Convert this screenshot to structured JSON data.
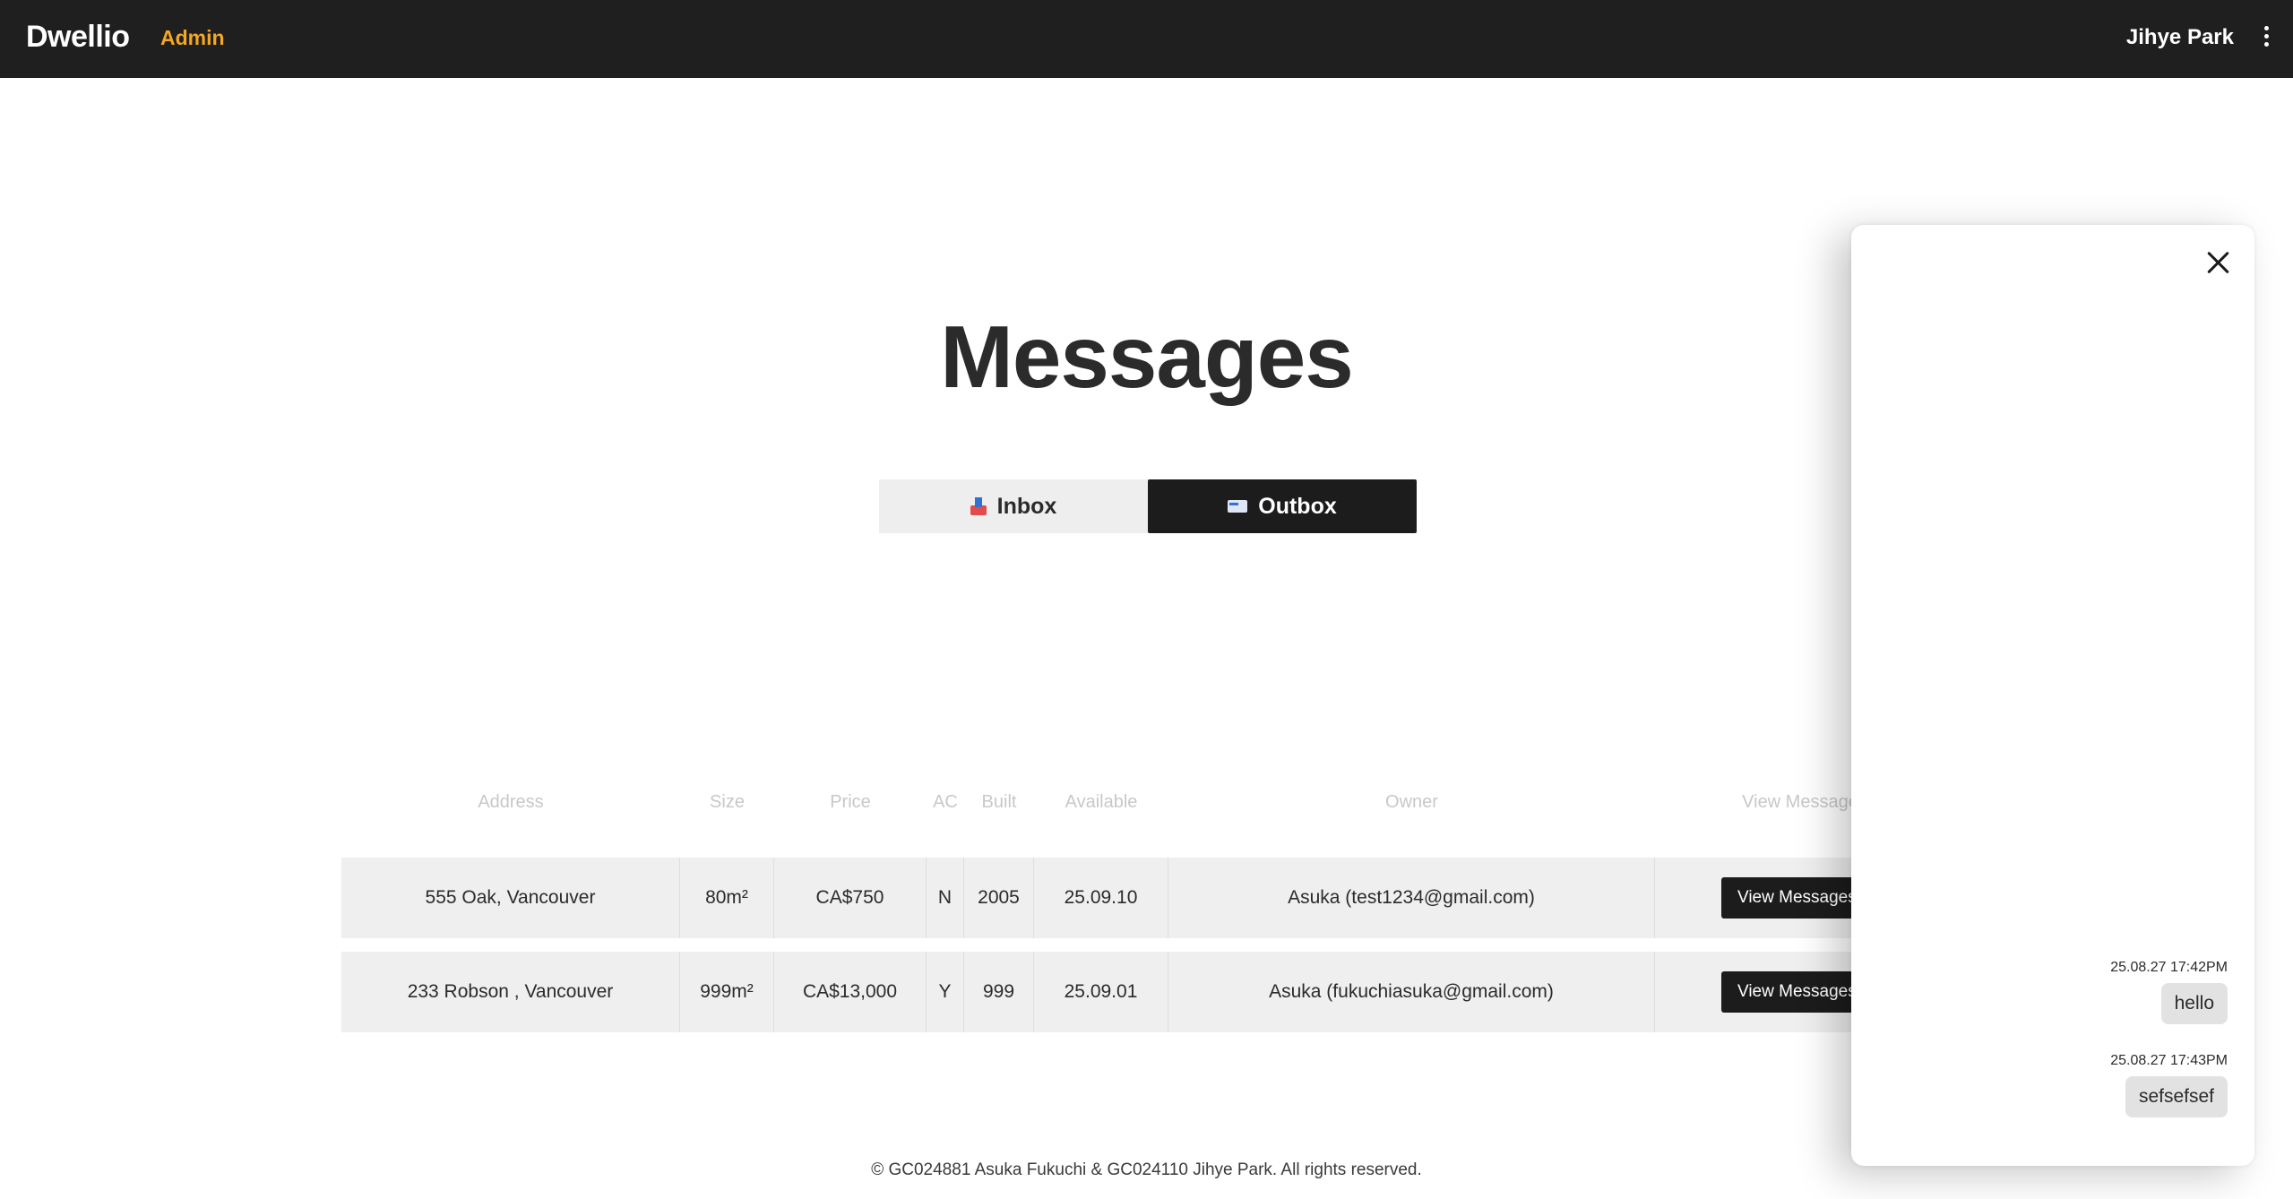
{
  "header": {
    "brand": "Dwellio",
    "admin_label": "Admin",
    "user_name": "Jihye Park",
    "menu_icon": "kebab-menu-icon"
  },
  "page": {
    "title": "Messages"
  },
  "tabs": [
    {
      "label": "Inbox",
      "icon": "inbox-tray-icon",
      "active": false
    },
    {
      "label": "Outbox",
      "icon": "outbox-envelope-icon",
      "active": true
    }
  ],
  "table": {
    "columns": [
      "Address",
      "Size",
      "Price",
      "AC",
      "Built",
      "Available",
      "Owner",
      "View Messages"
    ],
    "rows": [
      {
        "address": "555 Oak, Vancouver",
        "size": "80m²",
        "price": "CA$750",
        "ac": "N",
        "built": "2005",
        "available": "25.09.10",
        "owner": "Asuka (test1234@gmail.com)",
        "button": "View Messages"
      },
      {
        "address": "233 Robson , Vancouver",
        "size": "999m²",
        "price": "CA$13,000",
        "ac": "Y",
        "built": "999",
        "available": "25.09.01",
        "owner": "Asuka (fukuchiasuka@gmail.com)",
        "button": "View Messages"
      }
    ]
  },
  "footer": {
    "text": "© GC024881 Asuka Fukuchi & GC024110 Jihye Park. All rights reserved."
  },
  "chat": {
    "close_icon": "close-icon",
    "messages": [
      {
        "time": "25.08.27 17:42PM",
        "text": "hello"
      },
      {
        "time": "25.08.27 17:43PM",
        "text": "sefsefsef"
      }
    ]
  }
}
